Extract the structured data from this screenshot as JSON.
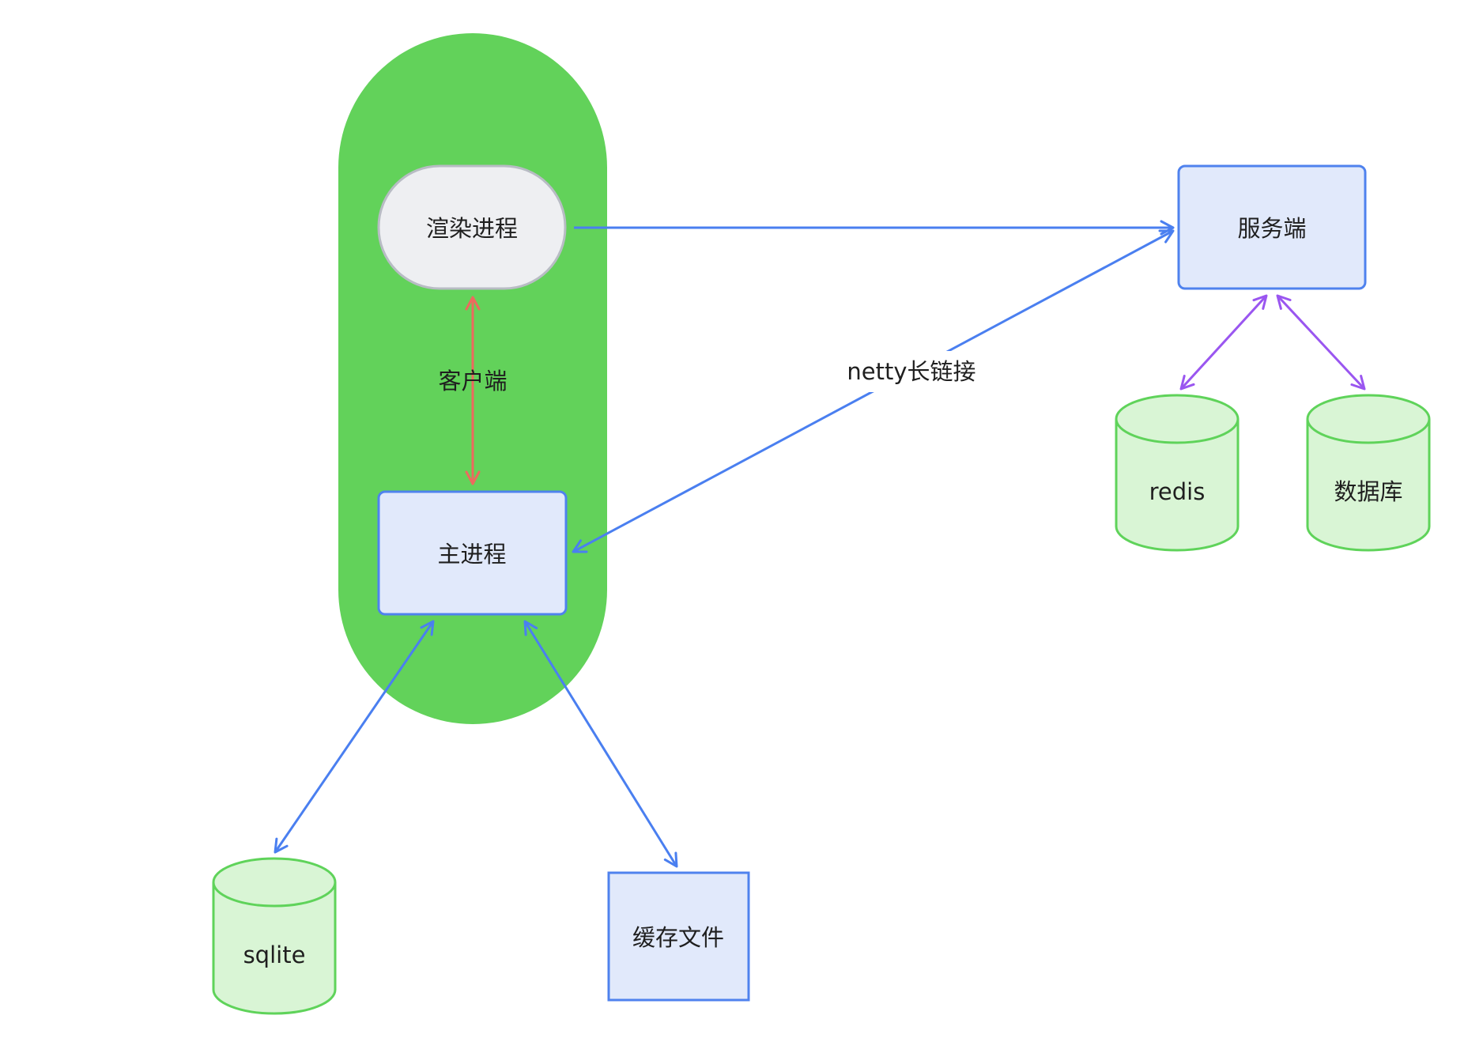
{
  "client_group": {
    "label": "客户端"
  },
  "nodes": {
    "render_process": {
      "label": "渲染进程"
    },
    "main_process": {
      "label": "主进程"
    },
    "server": {
      "label": "服务端"
    },
    "redis": {
      "label": "redis"
    },
    "database": {
      "label": "数据库"
    },
    "sqlite": {
      "label": "sqlite"
    },
    "cache_file": {
      "label": "缓存文件"
    }
  },
  "edges": {
    "netty": {
      "label": "netty长链接"
    }
  },
  "colors": {
    "client_fill": "#62d25a",
    "process_fill": "#e1e9fb",
    "process_stroke": "#4f82ee",
    "render_fill": "#eeeff2",
    "render_stroke": "#b8bcc4",
    "db_fill": "#d9f5d5",
    "db_stroke": "#5fd35a",
    "arrow_blue": "#4a7ff0",
    "arrow_red": "#ec6a5e",
    "arrow_purple": "#9a56f0"
  }
}
